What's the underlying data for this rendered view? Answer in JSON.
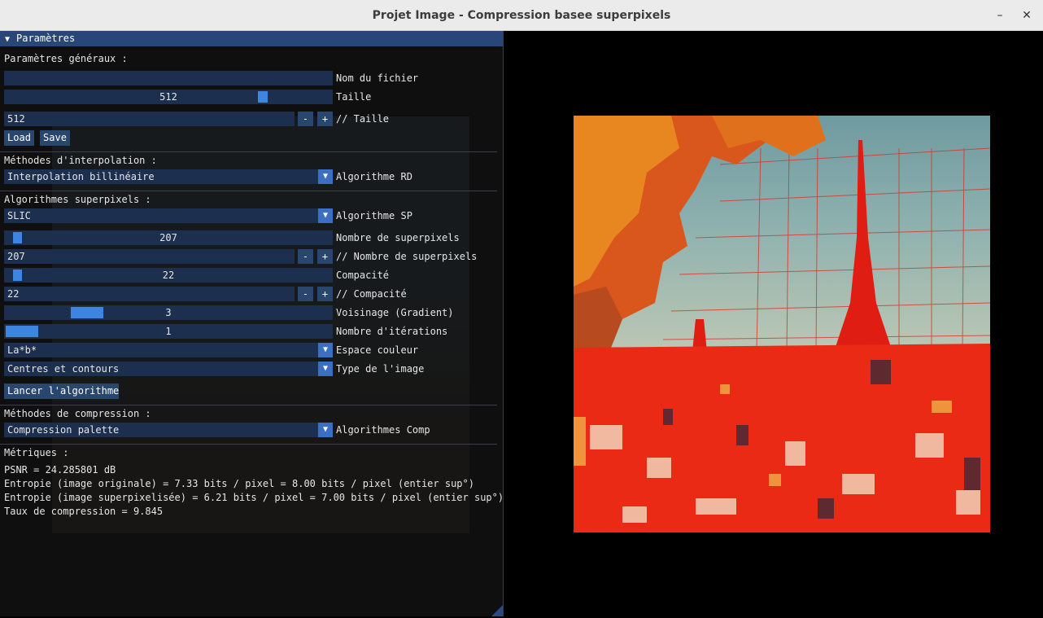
{
  "window": {
    "title": "Projet Image - Compression basee superpixels",
    "minimize_glyph": "–",
    "close_glyph": "✕"
  },
  "panel": {
    "header": "Paramètres",
    "general": {
      "heading": "Paramètres généraux :",
      "filename_value": "",
      "filename_label": "Nom du fichier",
      "size_slider_value": "512",
      "size_slider_label": "Taille",
      "size_slider_fraction": 0.78,
      "size_input_value": "512",
      "size_input_label": "// Taille",
      "minus": "-",
      "plus": "+",
      "load_label": "Load",
      "save_label": "Save"
    },
    "interpolation": {
      "heading": "Méthodes d'interpolation :",
      "combo_value": "Interpolation billinéaire",
      "combo_label": "Algorithme RD"
    },
    "superpixels": {
      "heading": "Algorithmes superpixels :",
      "algo_value": "SLIC",
      "algo_label": "Algorithme SP",
      "count_slider_value": "207",
      "count_slider_label": "Nombre de superpixels",
      "count_input_value": "207",
      "count_input_label": "// Nombre de superpixels",
      "compact_slider_value": "22",
      "compact_slider_label": "Compacité",
      "compact_input_value": "22",
      "compact_input_label": "// Compacité",
      "neighborhood_value": "3",
      "neighborhood_label": "Voisinage (Gradient)",
      "iterations_value": "1",
      "iterations_label": "Nombre d'itérations",
      "colorspace_value": "La*b*",
      "colorspace_label": "Espace couleur",
      "imagetype_value": "Centres et contours",
      "imagetype_label": "Type de l'image",
      "run_label": "Lancer l'algorithme"
    },
    "compression": {
      "heading": "Méthodes de compression :",
      "combo_value": "Compression palette",
      "combo_label": "Algorithmes Comp"
    },
    "metrics": {
      "heading": "Métriques :",
      "psnr": "PSNR = 24.285801 dB",
      "entropy_original": "Entropie (image originale) = 7.33 bits / pixel = 8.00 bits / pixel (entier sup°)",
      "entropy_superpixel": "Entropie (image superpixelisée) = 6.21 bits / pixel = 7.00 bits / pixel (entier sup°)",
      "compression_rate": "Taux de compression = 9.845"
    }
  },
  "colors": {
    "panel_header": "#284678",
    "widget_bg": "#1d2f4f",
    "slider_grab": "#3d85e0",
    "contour": "#ff1a1a"
  }
}
